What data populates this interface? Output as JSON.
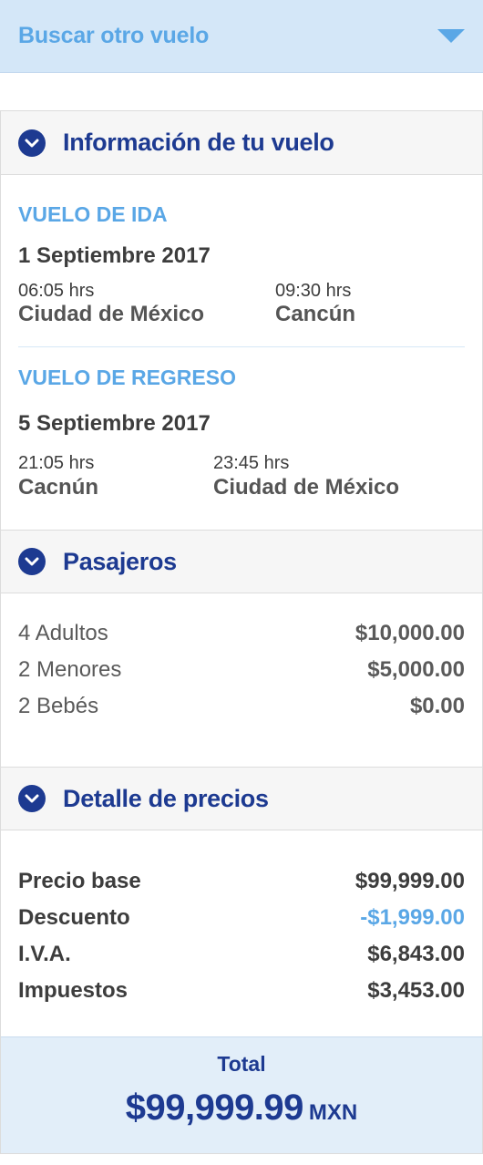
{
  "search": {
    "label": "Buscar otro vuelo"
  },
  "flight_info": {
    "title": "Información de tu vuelo",
    "outbound": {
      "label": "VUELO DE IDA",
      "date": "1 Septiembre 2017",
      "depart_time": "06:05 hrs",
      "depart_city": "Ciudad de México",
      "arrive_time": "09:30 hrs",
      "arrive_city": "Cancún"
    },
    "return": {
      "label": "VUELO DE REGRESO",
      "date": "5 Septiembre 2017",
      "depart_time": "21:05 hrs",
      "depart_city": "Cacnún",
      "arrive_time": "23:45 hrs",
      "arrive_city": "Ciudad de México"
    }
  },
  "passengers": {
    "title": "Pasajeros",
    "items": [
      {
        "label": "4 Adultos",
        "amount": "$10,000.00"
      },
      {
        "label": "2 Menores",
        "amount": "$5,000.00"
      },
      {
        "label": "2 Bebés",
        "amount": "$0.00"
      }
    ]
  },
  "prices": {
    "title": "Detalle de precios",
    "items": [
      {
        "label": "Precio base",
        "amount": "$99,999.00"
      },
      {
        "label": "Descuento",
        "amount": "-$1,999.00"
      },
      {
        "label": "I.V.A.",
        "amount": "$6,843.00"
      },
      {
        "label": "Impuestos",
        "amount": "$3,453.00"
      }
    ],
    "discount_color": "#5aa7e6"
  },
  "total": {
    "label": "Total",
    "amount": "$99,999.99",
    "currency": "MXN"
  },
  "colors": {
    "primary": "#1d3a91",
    "accent": "#5aa7e6",
    "search_bg": "#d4e7f8",
    "total_bg": "#e2eef9"
  }
}
